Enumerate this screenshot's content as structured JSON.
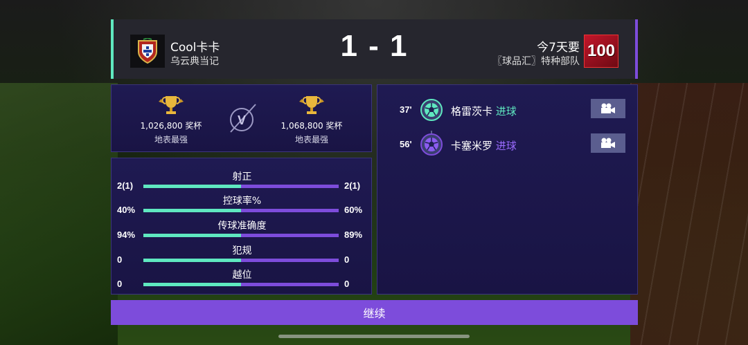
{
  "header": {
    "home": {
      "name": "Cool卡卡",
      "subtitle": "乌云典当记",
      "badge_icon": "portugal-crest-icon"
    },
    "score": "1 - 1",
    "away": {
      "name": "今7天要",
      "subtitle": "〖球品汇〗特种部队",
      "badge_text": "100"
    },
    "colors": {
      "home": "#5fe8c0",
      "away": "#7d4cdb"
    }
  },
  "trophies": {
    "home": {
      "count": "1,026,800 奖杯",
      "label": "地表最强"
    },
    "away": {
      "count": "1,068,800 奖杯",
      "label": "地表最强"
    },
    "vs": "V"
  },
  "stats": [
    {
      "label": "射正",
      "home": "2(1)",
      "away": "2(1)",
      "home_share": 0.5
    },
    {
      "label": "控球率%",
      "home": "40%",
      "away": "60%",
      "home_share": 0.5
    },
    {
      "label": "传球准确度",
      "home": "94%",
      "away": "89%",
      "home_share": 0.5
    },
    {
      "label": "犯规",
      "home": "0",
      "away": "0",
      "home_share": 0.5
    },
    {
      "label": "越位",
      "home": "0",
      "away": "0",
      "home_share": 0.5
    }
  ],
  "events": [
    {
      "minute": "37'",
      "player": "格雷茨卡",
      "type": "进球",
      "team": "home"
    },
    {
      "minute": "56'",
      "player": "卡塞米罗",
      "type": "进球",
      "team": "away"
    }
  ],
  "continue_label": "继续"
}
